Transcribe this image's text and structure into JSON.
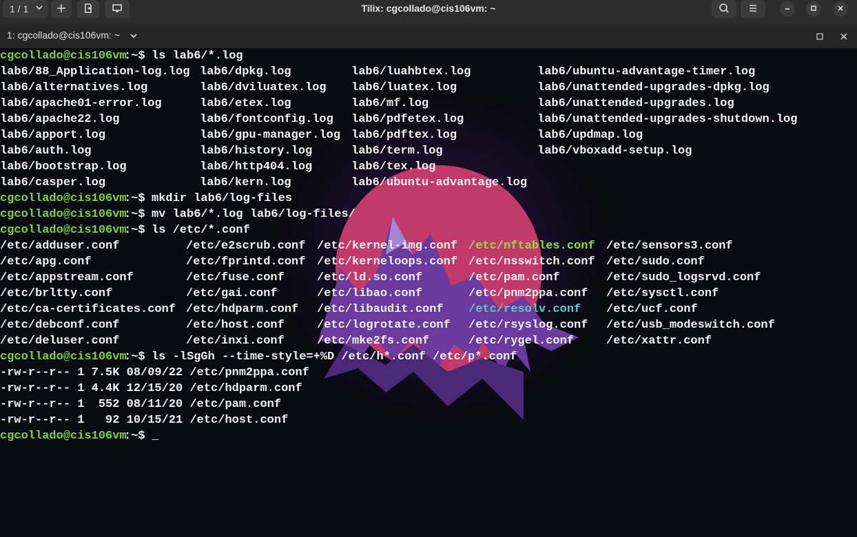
{
  "window": {
    "title": "Tilix: cgcollado@cis106vm: ~",
    "session_counter": "1 / 1",
    "session_tab_label": "1: cgcollado@cis106vm: ~"
  },
  "prompt": {
    "user_host": "cgcollado@cis106vm",
    "cwd_sep": ":~$"
  },
  "terminal": {
    "cmd1": "ls lab6/*.log",
    "log_files": [
      [
        "lab6/88_Application-log.log",
        "lab6/dpkg.log",
        "lab6/luahbtex.log",
        "lab6/ubuntu-advantage-timer.log"
      ],
      [
        "lab6/alternatives.log",
        "lab6/dviluatex.log",
        "lab6/luatex.log",
        "lab6/unattended-upgrades-dpkg.log"
      ],
      [
        "lab6/apache01-error.log",
        "lab6/etex.log",
        "lab6/mf.log",
        "lab6/unattended-upgrades.log"
      ],
      [
        "lab6/apache22.log",
        "lab6/fontconfig.log",
        "lab6/pdfetex.log",
        "lab6/unattended-upgrades-shutdown.log"
      ],
      [
        "lab6/apport.log",
        "lab6/gpu-manager.log",
        "lab6/pdftex.log",
        "lab6/updmap.log"
      ],
      [
        "lab6/auth.log",
        "lab6/history.log",
        "lab6/term.log",
        "lab6/vboxadd-setup.log"
      ],
      [
        "lab6/bootstrap.log",
        "lab6/http404.log",
        "lab6/tex.log",
        ""
      ],
      [
        "lab6/casper.log",
        "lab6/kern.log",
        "lab6/ubuntu-advantage.log",
        ""
      ]
    ],
    "cmd2": "mkdir lab6/log-files",
    "cmd3": "mv lab6/*.log lab6/log-files/",
    "cmd4": "ls /etc/*.conf",
    "conf_files": [
      [
        "/etc/adduser.conf",
        "/etc/e2scrub.conf",
        "/etc/kernel-img.conf",
        "/etc/nftables.conf",
        "/etc/sensors3.conf"
      ],
      [
        "/etc/apg.conf",
        "/etc/fprintd.conf",
        "/etc/kerneloops.conf",
        "/etc/nsswitch.conf",
        "/etc/sudo.conf"
      ],
      [
        "/etc/appstream.conf",
        "/etc/fuse.conf",
        "/etc/ld.so.conf",
        "/etc/pam.conf",
        "/etc/sudo_logsrvd.conf"
      ],
      [
        "/etc/brltty.conf",
        "/etc/gai.conf",
        "/etc/libao.conf",
        "/etc/pnm2ppa.conf",
        "/etc/sysctl.conf"
      ],
      [
        "/etc/ca-certificates.conf",
        "/etc/hdparm.conf",
        "/etc/libaudit.conf",
        "/etc/resolv.conf",
        "/etc/ucf.conf"
      ],
      [
        "/etc/debconf.conf",
        "/etc/host.conf",
        "/etc/logrotate.conf",
        "/etc/rsyslog.conf",
        "/etc/usb_modeswitch.conf"
      ],
      [
        "/etc/deluser.conf",
        "/etc/inxi.conf",
        "/etc/mke2fs.conf",
        "/etc/rygel.conf",
        "/etc/xattr.conf"
      ]
    ],
    "conf_exec_file": "/etc/nftables.conf",
    "conf_link_file": "/etc/resolv.conf",
    "cmd5": "ls -lSgGh --time-style=+%D /etc/h*.conf /etc/p*.conf",
    "long_listing": [
      "-rw-r--r-- 1 7.5K 08/09/22 /etc/pnm2ppa.conf",
      "-rw-r--r-- 1 4.4K 12/15/20 /etc/hdparm.conf",
      "-rw-r--r-- 1  552 08/11/20 /etc/pam.conf",
      "-rw-r--r-- 1   92 10/15/21 /etc/host.conf"
    ],
    "cursor": "_"
  },
  "colors": {
    "prompt": "#7cd23a",
    "text": "#f2f2f2",
    "executable": "#9ad94a",
    "symlink": "#5bc8cc",
    "background": "#0a0a12"
  },
  "icons": {
    "session_dropdown": "chevron-down-icon",
    "add_terminal": "plus-icon",
    "new_session": "new-session-icon",
    "sync_input": "broadcast-icon",
    "search": "search-icon",
    "menu": "hamburger-menu-icon",
    "minimize": "minimize-icon",
    "maximize": "maximize-icon",
    "close": "close-icon",
    "maximize_terminal": "maximize-terminal-icon",
    "close_terminal": "close-terminal-icon"
  }
}
